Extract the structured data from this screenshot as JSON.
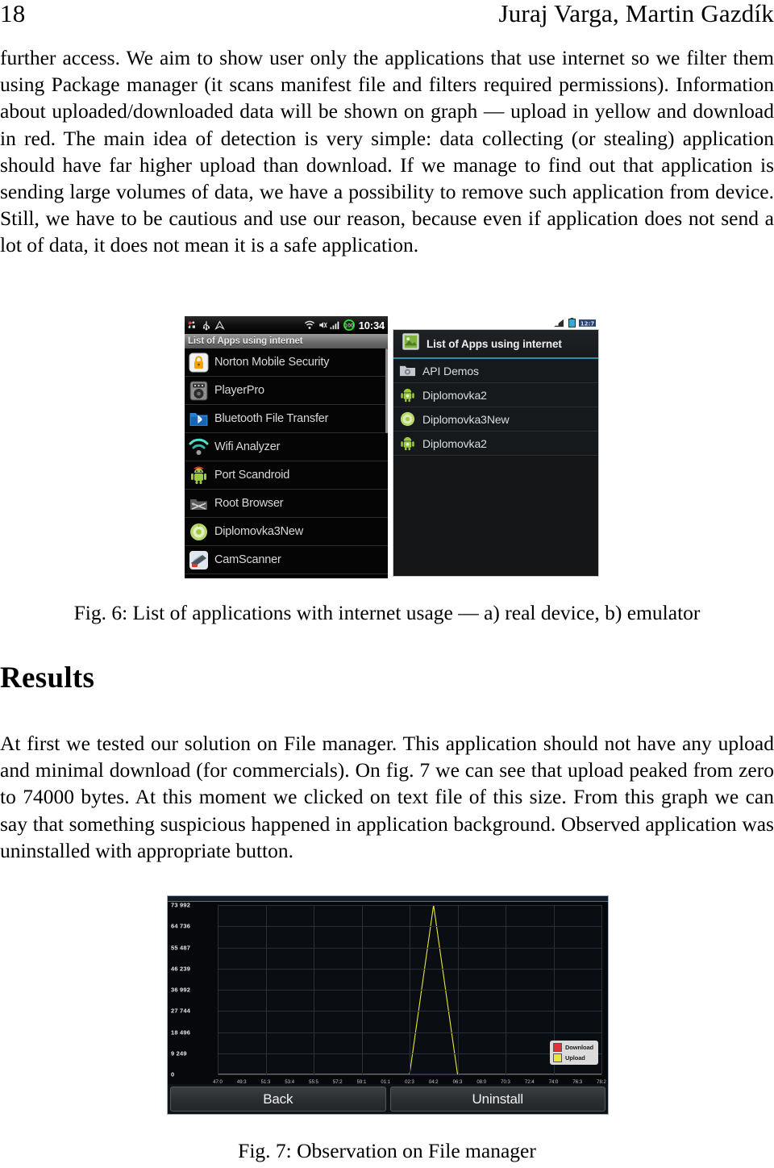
{
  "header": {
    "page_number": "18",
    "authors": "Juraj Varga, Martin Gazdík"
  },
  "paragraphs": {
    "p1": "further access. We aim to show user only the applications that use internet so we filter them using Package manager (it scans manifest file and filters required permissions). Information about uploaded/downloaded data will be shown on graph — upload in yellow and download in red. The main idea of detection is very simple: data collecting (or stealing) application should have far higher upload than download. If we manage to find out that application is sending large volumes of data, we have a possibility to remove such application from device. Still, we have to be cautious and use our reason, because even if application does not send a lot of data, it does not mean it is a safe application.",
    "p2": "At first we tested our solution on File manager. This application should not have any upload and minimal download (for commercials). On fig. 7 we can see that upload peaked from zero to 74000 bytes. At this moment we clicked on text file of this size. From this graph we can say that something suspicious happened in application background. Observed application was uninstalled with appropriate button."
  },
  "section": {
    "results_heading": "Results"
  },
  "figure6": {
    "caption": "Fig. 6: List of applications with internet usage — a) real device, b) emulator",
    "real_device": {
      "status_bar": {
        "clock": "10:34",
        "battery_level": "100",
        "icons": [
          "sync-icon",
          "usb-icon",
          "caret-up-icon",
          "wifi-icon",
          "mute-icon",
          "signal-bars-icon",
          "battery-icon"
        ]
      },
      "list_title": "List of Apps using internet",
      "apps": [
        {
          "name": "Norton Mobile Security",
          "icon": "padlock-icon"
        },
        {
          "name": "PlayerPro",
          "icon": "speaker-icon"
        },
        {
          "name": "Bluetooth File Transfer",
          "icon": "bluetooth-folder-icon"
        },
        {
          "name": "Wifi Analyzer",
          "icon": "wifi-waves-icon"
        },
        {
          "name": "Port Scandroid",
          "icon": "android-robot-icon"
        },
        {
          "name": "Root Browser",
          "icon": "root-folder-icon"
        },
        {
          "name": "Diplomovka3New",
          "icon": "android-head-icon"
        },
        {
          "name": "CamScanner",
          "icon": "scanner-icon"
        }
      ]
    },
    "emulator": {
      "status_bar": {
        "icons": [
          "signal-bars-icon",
          "battery-icon",
          "clock-icon"
        ]
      },
      "action_bar": {
        "title": "List of Apps using internet",
        "icon": "app-launcher-icon"
      },
      "apps": [
        {
          "name": "API Demos",
          "icon": "gear-folder-icon"
        },
        {
          "name": "Diplomovka2",
          "icon": "android-robot-icon"
        },
        {
          "name": "Diplomovka3New",
          "icon": "android-robot-icon"
        },
        {
          "name": "Diplomovka2",
          "icon": "android-robot-icon"
        }
      ]
    }
  },
  "figure7": {
    "caption": "Fig. 7: Observation on File manager",
    "buttons": {
      "back": "Back",
      "uninstall": "Uninstall"
    }
  },
  "chart_data": {
    "type": "line",
    "title": "",
    "xlabel": "",
    "ylabel": "",
    "ylim": [
      0,
      73992
    ],
    "ytick_labels": [
      "73 992",
      "64 736",
      "55 487",
      "46 239",
      "36 992",
      "27 744",
      "18 496",
      "9 249",
      "0"
    ],
    "ytick_values": [
      73992,
      64736,
      55487,
      46239,
      36992,
      27744,
      18496,
      9249,
      0
    ],
    "grid": true,
    "legend_position": "bottom-right",
    "x": [
      "47:0",
      "49:3",
      "51:3",
      "53:4",
      "55:5",
      "57:2",
      "59:1",
      "01:1",
      "02:3",
      "04:2",
      "06:3",
      "08:0",
      "70:3",
      "72:4",
      "74:0",
      "76:3",
      "78:2"
    ],
    "series": [
      {
        "name": "Download",
        "color": "#e03232",
        "values": [
          0,
          0,
          0,
          0,
          0,
          0,
          0,
          0,
          0,
          0,
          0,
          0,
          0,
          0,
          0,
          0,
          0
        ]
      },
      {
        "name": "Upload",
        "color": "#e8e83c",
        "values": [
          0,
          0,
          0,
          0,
          0,
          0,
          0,
          0,
          0,
          73992,
          0,
          0,
          0,
          0,
          0,
          0,
          0
        ]
      }
    ],
    "annotations": [
      "upload peaked from zero to 74000 bytes"
    ]
  },
  "colors": {
    "upload": "#e8e83c",
    "download": "#e03232",
    "chart_background": "#06080b",
    "grid": "#2a3037",
    "accent_blue": "#3a7ca5"
  }
}
